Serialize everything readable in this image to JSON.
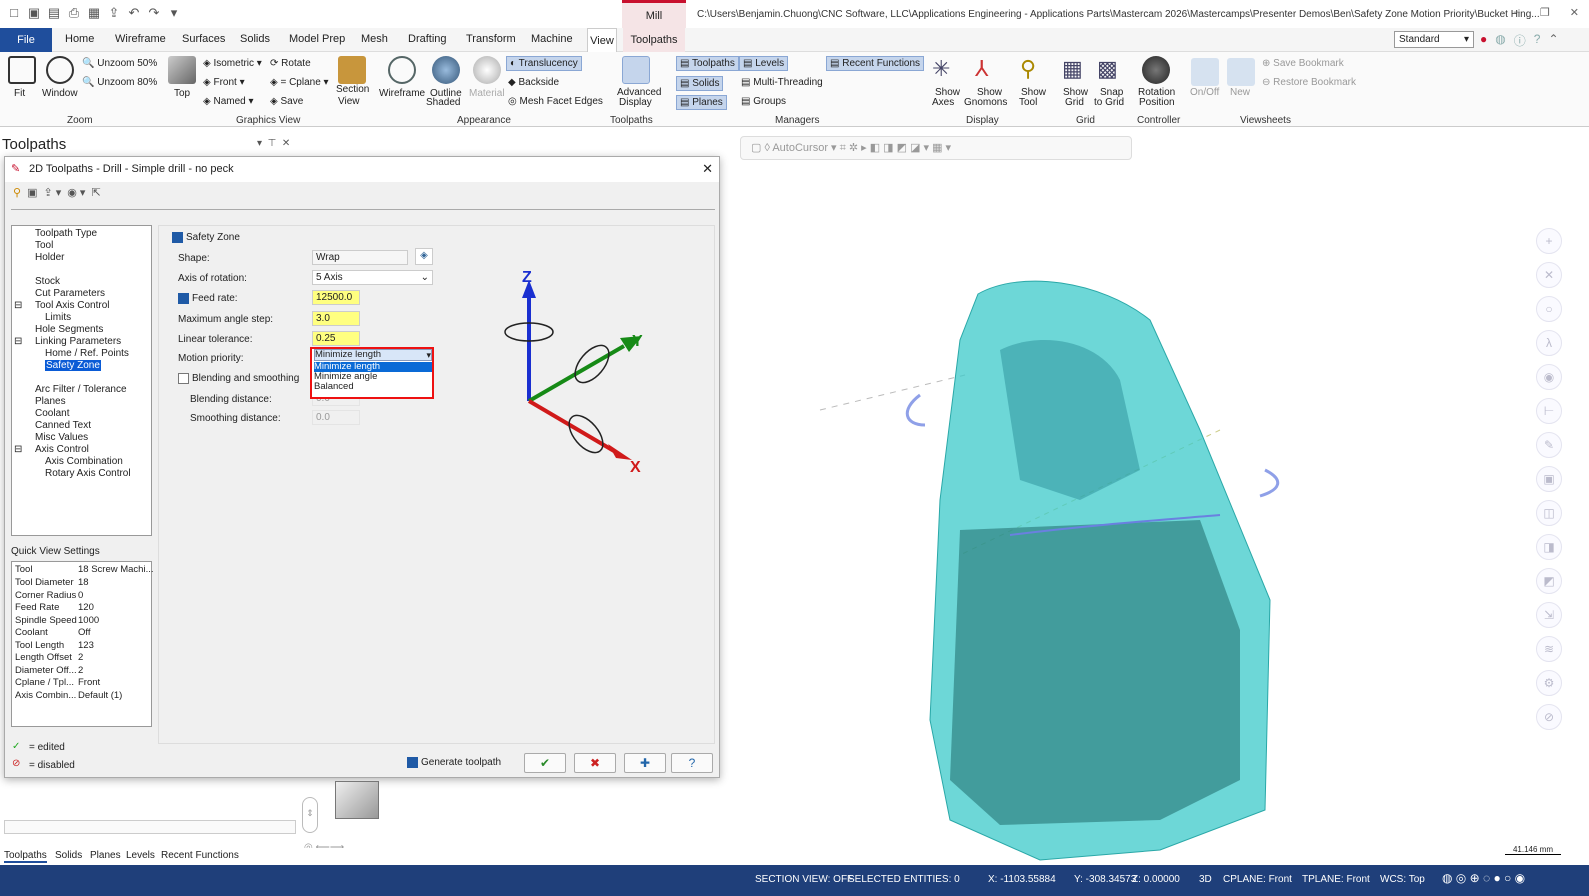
{
  "window": {
    "mill_label": "Mill",
    "path": "C:\\Users\\Benjamin.Chuong\\CNC Software, LLC\\Applications Engineering - Applications Parts\\Mastercam 2026\\Mastercamps\\Presenter Demos\\Ben\\Safety Zone Motion Priority\\Bucket Hing..."
  },
  "tabs": [
    "File",
    "Home",
    "Wireframe",
    "Surfaces",
    "Solids",
    "Model Prep",
    "Mesh",
    "Drafting",
    "Transform",
    "Machine",
    "View",
    "Toolpaths"
  ],
  "standard_select": "Standard",
  "ribbon": {
    "zoom": {
      "group": "Zoom",
      "fit": "Fit",
      "window": "Window",
      "unzoom50": "Unzoom 50%",
      "unzoom80": "Unzoom 80%"
    },
    "graphics": {
      "group": "Graphics View",
      "top": "Top",
      "isometric": "Isometric",
      "front": "Front",
      "named": "Named",
      "rotate": "Rotate",
      "cplane": "= Cplane",
      "save": "Save",
      "section": "Section",
      "section2": "View"
    },
    "appearance": {
      "group": "Appearance",
      "wireframe": "Wireframe",
      "outline": "Outline",
      "outline2": "Shaded",
      "material": "Material",
      "translucency": "Translucency",
      "backside": "Backside",
      "meshfacet": "Mesh Facet Edges"
    },
    "toolpaths": {
      "group": "Toolpaths",
      "advanced": "Advanced",
      "advanced2": "Display"
    },
    "managers": {
      "group": "Managers",
      "toolpaths": "Toolpaths",
      "levels": "Levels",
      "solids": "Solids",
      "multithreading": "Multi-Threading",
      "planes": "Planes",
      "groups": "Groups",
      "recent": "Recent Functions"
    },
    "display": {
      "group": "Display",
      "showaxes": "Show",
      "showaxes2": "Axes",
      "gnomons": "Show",
      "gnomons2": "Gnomons",
      "showtool": "Show",
      "showtool2": "Tool"
    },
    "grid": {
      "group": "Grid",
      "showgrid": "Show",
      "showgrid2": "Grid",
      "snap": "Snap",
      "snap2": "to Grid"
    },
    "controller": {
      "group": "Controller",
      "rotation": "Rotation",
      "rotation2": "Position"
    },
    "viewsheets": {
      "group": "Viewsheets",
      "onoff": "On/Off",
      "new": "New",
      "savebm": "Save Bookmark",
      "restorebm": "Restore Bookmark"
    }
  },
  "panel_title": "Toolpaths",
  "autocursor": "AutoCursor",
  "dialog": {
    "title": "2D Toolpaths - Drill - Simple drill - no peck",
    "tree": [
      "Toolpath Type",
      "Tool",
      "Holder",
      "Stock",
      "Cut Parameters",
      "Tool Axis Control",
      "Limits",
      "Hole Segments",
      "Linking Parameters",
      "Home / Ref. Points",
      "Safety Zone",
      "Arc Filter / Tolerance",
      "Planes",
      "Coolant",
      "Canned Text",
      "Misc Values",
      "Axis Control",
      "Axis Combination",
      "Rotary Axis Control"
    ],
    "qvs_title": "Quick View Settings",
    "qvs": [
      [
        "Tool",
        "18 Screw Machi..."
      ],
      [
        "Tool Diameter",
        "18"
      ],
      [
        "Corner Radius",
        "0"
      ],
      [
        "Feed Rate",
        "120"
      ],
      [
        "Spindle Speed",
        "1000"
      ],
      [
        "Coolant",
        "Off"
      ],
      [
        "Tool Length",
        "123"
      ],
      [
        "Length Offset",
        "2"
      ],
      [
        "Diameter Off...",
        "2"
      ],
      [
        "Cplane / Tpl...",
        "Front"
      ],
      [
        "Axis Combin...",
        "Default (1)"
      ]
    ],
    "safety_zone": "Safety Zone",
    "shape_label": "Shape:",
    "shape_value": "Wrap",
    "axis_label": "Axis of rotation:",
    "axis_value": "5 Axis",
    "feed_label": "Feed rate:",
    "feed_value": "12500.0",
    "maxangle_label": "Maximum angle step:",
    "maxangle_value": "3.0",
    "lintol_label": "Linear tolerance:",
    "lintol_value": "0.25",
    "motion_label": "Motion priority:",
    "motion_value": "Minimize length",
    "motion_options": [
      "Minimize length",
      "Minimize angle",
      "Balanced"
    ],
    "blending_label": "Blending and smoothing",
    "blenddist_label": "Blending distance:",
    "blenddist_value": "0.0",
    "smoothdist_label": "Smoothing distance:",
    "smoothdist_value": "0.0",
    "generate": "Generate toolpath",
    "edited": "= edited",
    "disabled": "= disabled"
  },
  "axes": {
    "x": "X",
    "y": "Y",
    "z": "Z"
  },
  "bottom_tabs": [
    "Toolpaths",
    "Solids",
    "Planes",
    "Levels",
    "Recent Functions"
  ],
  "scale": "41.146 mm",
  "status": {
    "section": "SECTION VIEW: OFF",
    "selected": "SELECTED ENTITIES: 0",
    "x": "X:  -1103.55884",
    "y": "Y:  -308.34573",
    "z": "Z:  0.00000",
    "mode": "3D",
    "cplane": "CPLANE: Front",
    "tplane": "TPLANE: Front",
    "wcs": "WCS: Top"
  },
  "colors": {
    "accent": "#1f4e9c",
    "status_bg": "#1f3f7a",
    "model": "#3cc9c9",
    "highlight_red": "#e11111"
  }
}
